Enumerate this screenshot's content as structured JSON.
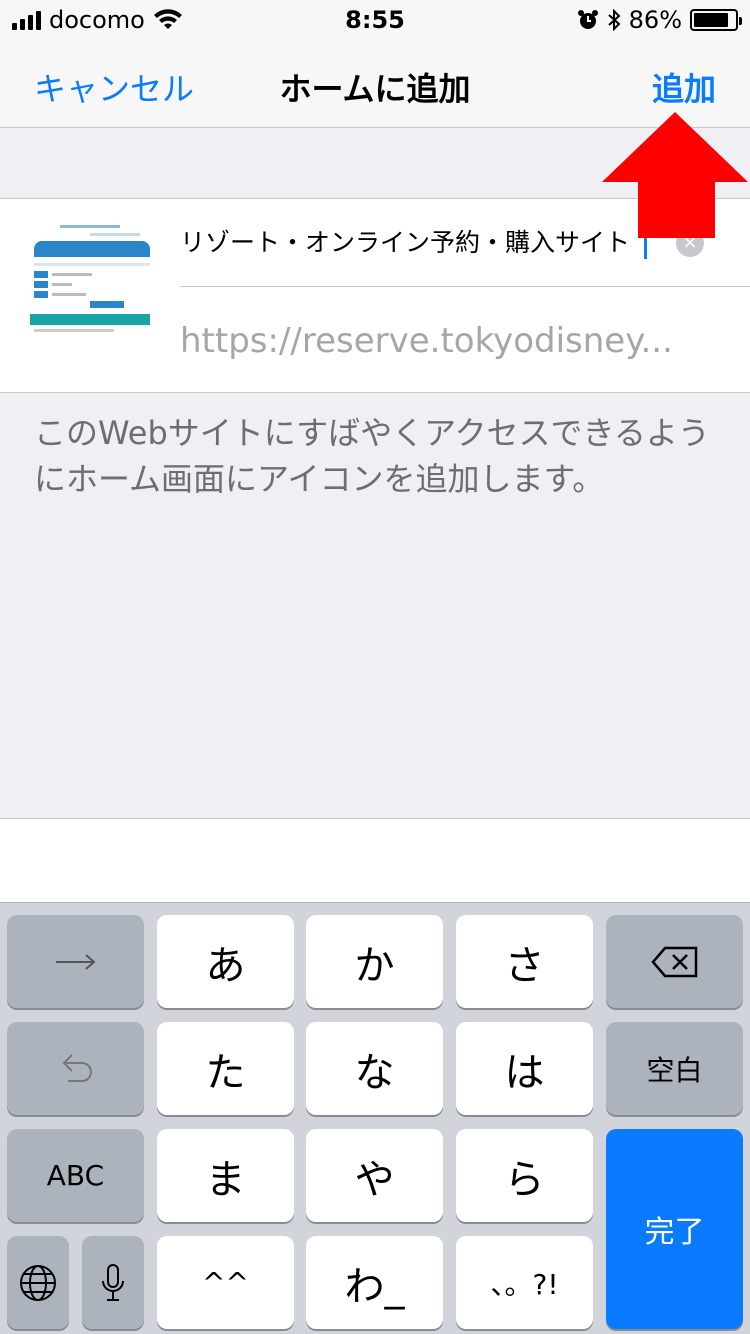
{
  "status_bar": {
    "carrier": "docomo",
    "time": "8:55",
    "battery_percent": "86%",
    "battery_level": 0.86
  },
  "nav": {
    "cancel_label": "キャンセル",
    "title": "ホームに追加",
    "add_label": "追加"
  },
  "bookmark": {
    "title": "リゾート・オンライン予約・購入サイト",
    "url": "https://reserve.tokyodisney...",
    "clear_glyph": "×"
  },
  "description": "このWebサイトにすばやくアクセスできるようにホーム画面にアイコンを追加します。",
  "keyboard": {
    "row1": [
      "→",
      "あ",
      "か",
      "さ",
      "⌫"
    ],
    "row2": [
      "↺",
      "た",
      "な",
      "は",
      "空白"
    ],
    "row3": [
      "ABC",
      "ま",
      "や",
      "ら"
    ],
    "row4": [
      "🌐",
      "🎤",
      "^^",
      "わ_",
      "、。?!"
    ],
    "done_label": "完了"
  },
  "colors": {
    "accent": "#0a7aff",
    "arrow": "#ff0000",
    "background": "#efeff4"
  }
}
